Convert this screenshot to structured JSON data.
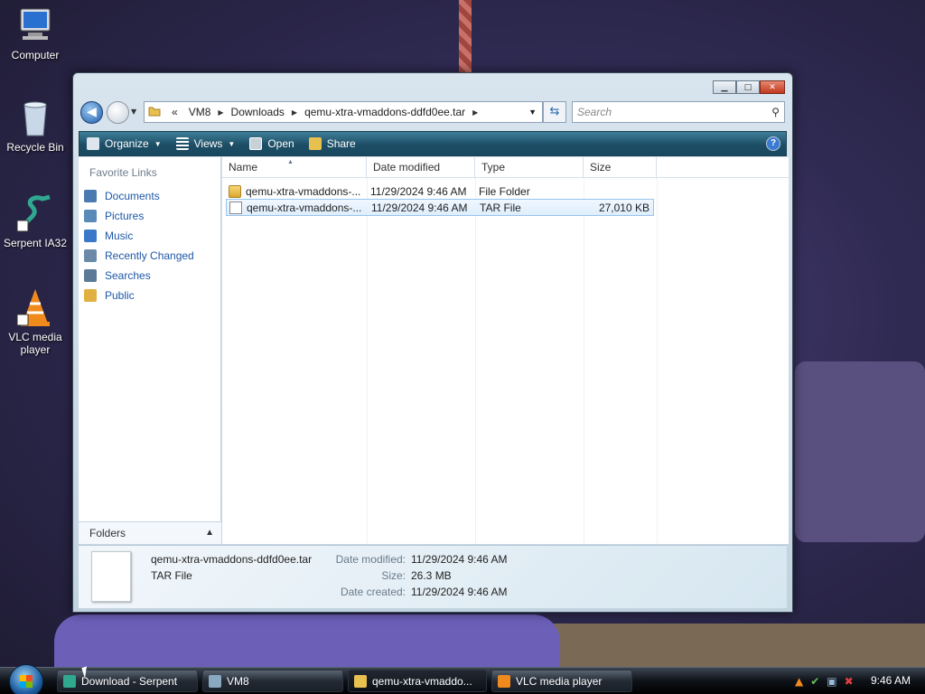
{
  "desktop_icons": [
    {
      "label": "Computer",
      "icon": "computer-icon"
    },
    {
      "label": "Recycle Bin",
      "icon": "recycle-bin-icon"
    },
    {
      "label": "Serpent IA32",
      "icon": "serpent-icon"
    },
    {
      "label": "VLC media player",
      "icon": "vlc-icon"
    }
  ],
  "window": {
    "address": {
      "overflow": "«",
      "segments": [
        "VM8",
        "Downloads",
        "qemu-xtra-vmaddons-ddfd0ee.tar"
      ]
    },
    "search_placeholder": "Search",
    "toolbar": {
      "organize": "Organize",
      "views": "Views",
      "open": "Open",
      "share": "Share",
      "help": "?"
    },
    "nav": {
      "heading": "Favorite Links",
      "items": [
        {
          "label": "Documents",
          "color": "#4a7ab0"
        },
        {
          "label": "Pictures",
          "color": "#5a8ab8"
        },
        {
          "label": "Music",
          "color": "#3a78c8"
        },
        {
          "label": "Recently Changed",
          "color": "#6a8aa8"
        },
        {
          "label": "Searches",
          "color": "#5a7a98"
        },
        {
          "label": "Public",
          "color": "#e0b040"
        }
      ],
      "folders_label": "Folders"
    },
    "columns": [
      "Name",
      "Date modified",
      "Type",
      "Size"
    ],
    "files": [
      {
        "name": "qemu-xtra-vmaddons-...",
        "date": "11/29/2024 9:46 AM",
        "type": "File Folder",
        "size": "",
        "kind": "folder"
      },
      {
        "name": "qemu-xtra-vmaddons-...",
        "date": "11/29/2024 9:46 AM",
        "type": "TAR File",
        "size": "27,010 KB",
        "kind": "file",
        "selected": true
      }
    ],
    "details": {
      "name": "qemu-xtra-vmaddons-ddfd0ee.tar",
      "type": "TAR File",
      "date_modified_label": "Date modified:",
      "date_modified": "11/29/2024 9:46 AM",
      "size_label": "Size:",
      "size": "26.3 MB",
      "date_created_label": "Date created:",
      "date_created": "11/29/2024 9:46 AM"
    }
  },
  "taskbar": {
    "buttons": [
      {
        "label": "Download - Serpent",
        "icon": "serpent-icon"
      },
      {
        "label": "VM8",
        "icon": "vm-icon"
      },
      {
        "label": "qemu-xtra-vmaddo...",
        "icon": "folder-icon",
        "active": true
      },
      {
        "label": "VLC media player",
        "icon": "vlc-icon"
      }
    ],
    "clock": "9:46 AM"
  },
  "colors": {
    "accent": "#1d58a8",
    "toolbar": "#1d4e66",
    "selection": "#dfeefc"
  }
}
